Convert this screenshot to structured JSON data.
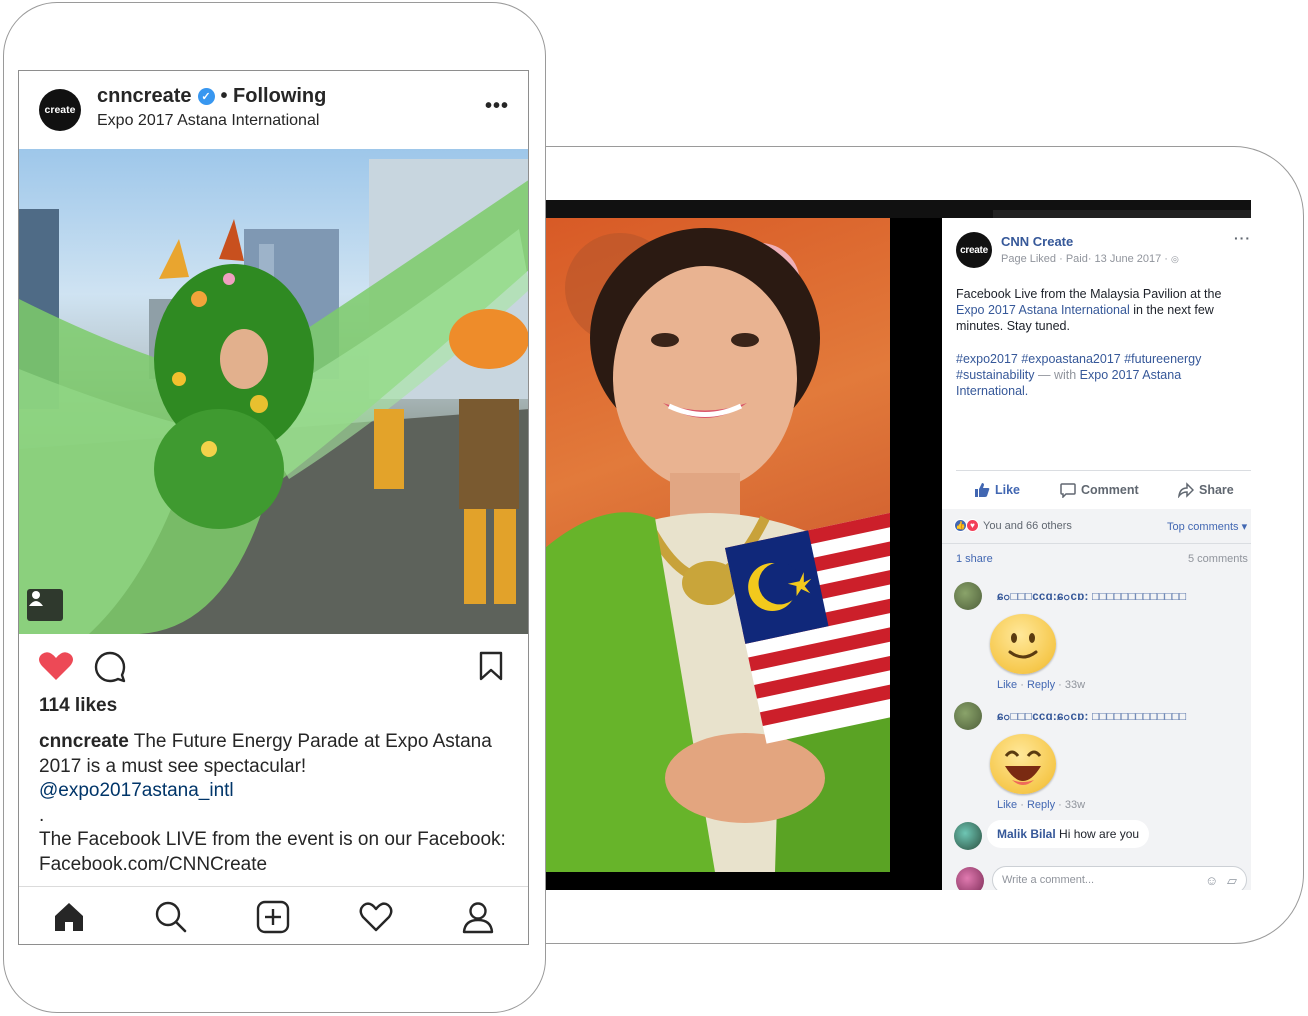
{
  "instagram": {
    "logo_text": "create",
    "username": "cnncreate",
    "verified_mark": "✓",
    "follow_status": "• Following",
    "location": "Expo 2017 Astana International",
    "more": "•••",
    "likes": "114 likes",
    "caption": {
      "user": "cnncreate",
      "line1": "The Future Energy Parade at Expo Astana 2017 is a must see spectacular!",
      "mention": "@expo2017astana_intl",
      "dot": ".",
      "line2": "The Facebook LIVE from the event is on our Facebook: Facebook.com/CNNCreate"
    },
    "icons": [
      "heart-icon",
      "comment-icon",
      "bookmark-icon",
      "home-icon",
      "search-icon",
      "add-post-icon",
      "activity-icon",
      "profile-icon"
    ],
    "colors": {
      "like_red": "#ed4956",
      "mention_blue": "#003569"
    }
  },
  "facebook": {
    "logo_text": "create",
    "page_name": "CNN Create",
    "meta": "Page Liked · Paid· 13 June 2017 ·",
    "globe": "🌐",
    "more": "···",
    "post_text_1": "Facebook Live from the Malaysia Pavilion at the ",
    "post_link": "Expo 2017 Astana International",
    "post_text_2": " in the next few minutes. Stay tuned.",
    "hashtags": "#expo2017 #expoastana2017 #futureenergy #sustainability",
    "with_text": " — with ",
    "with_link": "Expo 2017 Astana International.",
    "actions": {
      "like": "Like",
      "comment": "Comment",
      "share": "Share"
    },
    "reactions_text": "You and 66 others",
    "top_comments": "Top comments ▾",
    "shares": "1 share",
    "comments_count": "5 comments",
    "comments": [
      {
        "name": "ɕ၀□□□ϲϲɑ:ɕ၀ϲɒ: □□□□□□□□□□□□□",
        "meta_like": "Like",
        "meta_reply": "Reply",
        "meta_time": "· 33w",
        "emoji": "smile"
      },
      {
        "name": "ɕ၀□□□ϲϲɑ:ɕ၀ϲɒ: □□□□□□□□□□□□□",
        "meta_like": "Like",
        "meta_reply": "Reply",
        "meta_time": "· 33w",
        "emoji": "laugh"
      }
    ],
    "reply": {
      "name": "Malik Bilal",
      "text": " Hi how are you"
    },
    "write_placeholder": "Write a comment...",
    "colors": {
      "fb_blue": "#4267b2",
      "link_blue": "#365899"
    }
  }
}
